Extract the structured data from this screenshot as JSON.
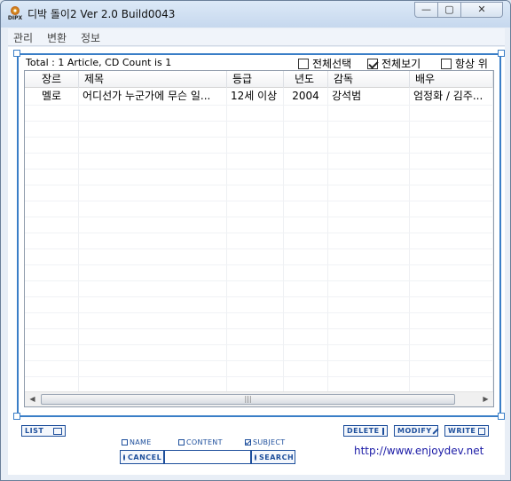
{
  "window": {
    "title": "디박 돌이2 Ver 2.0 Build0043",
    "app_icon_text": "DIPX",
    "minimize_symbol": "—",
    "maximize_symbol": "▢",
    "close_symbol": "✕"
  },
  "menu": [
    "관리",
    "변환",
    "정보"
  ],
  "summary": {
    "total_text": "Total : 1 Article, CD Count is 1"
  },
  "options": [
    {
      "label": "전체선택",
      "checked": false
    },
    {
      "label": "전체보기",
      "checked": true
    },
    {
      "label": "항상 위",
      "checked": false
    }
  ],
  "table": {
    "columns": [
      "장르",
      "제목",
      "등급",
      "년도",
      "감독",
      "배우"
    ],
    "rows": [
      [
        "멜로",
        "어디선가 누군가에 무슨 일...",
        "12세 이상",
        "2004",
        "강석범",
        "엄정화 / 김주..."
      ]
    ]
  },
  "scrollbar": {
    "left_arrow": "◀",
    "right_arrow": "▶",
    "thumb_grip": "|||"
  },
  "buttons": {
    "list": "LIST",
    "delete": "DELETE",
    "modify": "MODIFY",
    "write": "WRITE",
    "cancel": "CANCEL",
    "search": "SEARCH"
  },
  "search_options": [
    {
      "label": "NAME",
      "checked": false
    },
    {
      "label": "CONTENT",
      "checked": false
    },
    {
      "label": "SUBJECT",
      "checked": true
    }
  ],
  "search": {
    "value": ""
  },
  "footer": {
    "url": "http://www.enjoydev.net"
  }
}
